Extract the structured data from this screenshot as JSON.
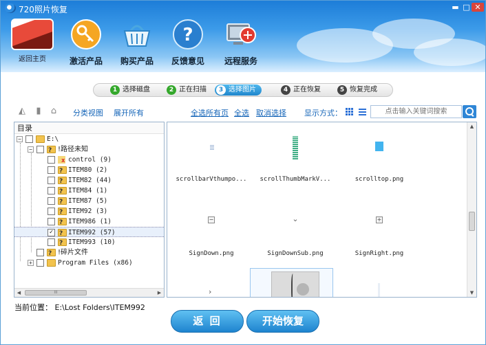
{
  "window": {
    "title": "720照片恢复",
    "controls": {
      "minimize": "▬",
      "maximize": "□",
      "close": "✕"
    }
  },
  "toolbar": {
    "home": {
      "label": "返回主页",
      "icon": "car-photo-icon"
    },
    "activate": {
      "label": "激活产品",
      "icon": "key-icon"
    },
    "buy": {
      "label": "购买产品",
      "icon": "shopping-basket-icon"
    },
    "feedback": {
      "label": "反馈意见",
      "icon": "question-icon"
    },
    "remote": {
      "label": "远程服务",
      "icon": "remote-service-icon"
    }
  },
  "steps": [
    {
      "num": "1",
      "label": "选择磁盘",
      "state": "done"
    },
    {
      "num": "2",
      "label": "正在扫描",
      "state": "done"
    },
    {
      "num": "3",
      "label": "选择图片",
      "state": "active"
    },
    {
      "num": "4",
      "label": "正在恢复",
      "state": "todo"
    },
    {
      "num": "5",
      "label": "恢复完成",
      "state": "todo"
    }
  ],
  "actionbar": {
    "category_view": "分类视图",
    "expand_all": "展开所有",
    "select_page": "全选所有页",
    "select_all": "全选",
    "deselect": "取消选择",
    "display_mode": "显示方式：",
    "search_placeholder": "点击输入关键词搜索"
  },
  "tree": {
    "header": "目录",
    "rows": [
      {
        "label": "E:\\",
        "expander": "−"
      },
      {
        "label": "!路径未知",
        "expander": "−"
      },
      {
        "label": "control (9)"
      },
      {
        "label": "ITEM80 (2)"
      },
      {
        "label": "ITEM82 (44)"
      },
      {
        "label": "ITEM84 (1)"
      },
      {
        "label": "ITEM87 (5)"
      },
      {
        "label": "ITEM92 (3)"
      },
      {
        "label": "ITEM986 (1)"
      },
      {
        "label": "ITEM992 (57)",
        "checked": "✓",
        "selected": true
      },
      {
        "label": "ITEM993 (10)"
      },
      {
        "label": "!碎片文件"
      },
      {
        "label": "Program Files (x86)",
        "expander": "+"
      }
    ],
    "scroll_grip": "III"
  },
  "images": [
    {
      "name": "scrollbarVthumpo..."
    },
    {
      "name": "scrollThumbMarkV..."
    },
    {
      "name": "scrolltop.png"
    },
    {
      "name": "SignDown.png"
    },
    {
      "name": "SignDownSub.png"
    },
    {
      "name": "SignRight.png"
    }
  ],
  "current_path": {
    "label": "当前位置：",
    "value": "E:\\Lost Folders\\ITEM992"
  },
  "buttons": {
    "back": "返 回",
    "start": "开始恢复"
  },
  "colors": {
    "accent": "#1f86cc",
    "header_top": "#1d7dd8",
    "link": "#1565b8",
    "done_step": "#35a82c"
  }
}
